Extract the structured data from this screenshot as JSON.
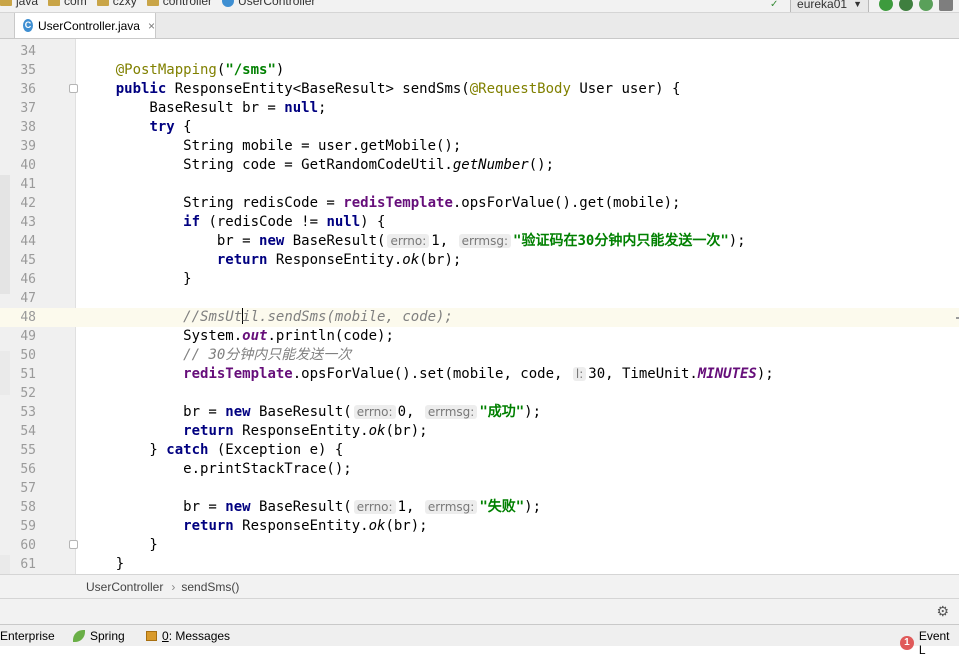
{
  "nav": {
    "crumbs": [
      "java",
      "com",
      "czxy",
      "controller",
      "UserController"
    ],
    "run_config": "eureka01"
  },
  "tab": {
    "label": "UserController.java",
    "close": "×"
  },
  "editor": {
    "lines": [
      {
        "n": "34",
        "html": ""
      },
      {
        "n": "35",
        "html": "    <span class=\"ann\">@PostMapping</span>(<span class=\"str\">\"/sms\"</span>)"
      },
      {
        "n": "36",
        "html": "    <span class=\"kw\">public</span> ResponseEntity&lt;BaseResult&gt; sendSms(<span class=\"ann\">@RequestBody</span> User user) {"
      },
      {
        "n": "37",
        "html": "        BaseResult br = <span class=\"kw\">null</span>;"
      },
      {
        "n": "38",
        "html": "        <span class=\"kw\">try</span> {"
      },
      {
        "n": "39",
        "html": "            String mobile = user.getMobile();"
      },
      {
        "n": "40",
        "html": "            String code = GetRandomCodeUtil.<span class=\"ital\">getNumber</span>();"
      },
      {
        "n": "41",
        "html": ""
      },
      {
        "n": "42",
        "html": "            String redisCode = <span class=\"fld\">redisTemplate</span>.opsForValue().get(mobile);"
      },
      {
        "n": "43",
        "html": "            <span class=\"kw\">if</span> (redisCode != <span class=\"kw\">null</span>) {"
      },
      {
        "n": "44",
        "html": "                br = <span class=\"kw\">new</span> BaseResult(<span class=\"hint\">errno:</span>1, <span class=\"hint\">errmsg:</span><span class=\"str\">\"验证码在30分钟内只能发送一次\"</span>);"
      },
      {
        "n": "45",
        "html": "                <span class=\"kw\">return</span> ResponseEntity.<span class=\"ital\">ok</span>(br);"
      },
      {
        "n": "46",
        "html": "            }"
      },
      {
        "n": "47",
        "html": ""
      },
      {
        "n": "48",
        "html": "            <span class=\"cmt\">//SmsUt<span class=\"cursor\"></span>il.sendSms(mobile, code);</span>",
        "current": true
      },
      {
        "n": "49",
        "html": "            System.<span class=\"sfld\">out</span>.println(code);"
      },
      {
        "n": "50",
        "html": "            <span class=\"cmt\">// 30分钟内只能发送一次</span>"
      },
      {
        "n": "51",
        "html": "            <span class=\"fld\">redisTemplate</span>.opsForValue().set(mobile, code, <span class=\"hint\">l:</span>30, TimeUnit.<span class=\"sfld\">MINUTES</span>);"
      },
      {
        "n": "52",
        "html": ""
      },
      {
        "n": "53",
        "html": "            br = <span class=\"kw\">new</span> BaseResult(<span class=\"hint\">errno:</span>0, <span class=\"hint\">errmsg:</span><span class=\"str\">\"成功\"</span>);"
      },
      {
        "n": "54",
        "html": "            <span class=\"kw\">return</span> ResponseEntity.<span class=\"ital\">ok</span>(br);"
      },
      {
        "n": "55",
        "html": "        } <span class=\"kw\">catch</span> (Exception e) {"
      },
      {
        "n": "56",
        "html": "            e.printStackTrace();"
      },
      {
        "n": "57",
        "html": ""
      },
      {
        "n": "58",
        "html": "            br = <span class=\"kw\">new</span> BaseResult(<span class=\"hint\">errno:</span>1, <span class=\"hint\">errmsg:</span><span class=\"str\">\"失败\"</span>);"
      },
      {
        "n": "59",
        "html": "            <span class=\"kw\">return</span> ResponseEntity.<span class=\"ital\">ok</span>(br);"
      },
      {
        "n": "60",
        "html": "        }"
      },
      {
        "n": "61",
        "html": "    }"
      }
    ],
    "fold_lines": [
      "36",
      "60"
    ]
  },
  "breadcrumb": {
    "class_name": "UserController",
    "separator": "›",
    "method": "sendSms()"
  },
  "status": {
    "enterprise": "Enterprise",
    "spring": "Spring",
    "messages_mnemonic": "0",
    "messages_label": ": Messages",
    "event_badge": "1",
    "event_label": "Event L"
  },
  "colors": {
    "keyword": "#000080",
    "annotation": "#808000",
    "string": "#008000",
    "field": "#660e7a",
    "comment": "#808080",
    "current_line": "#fcfaed"
  }
}
